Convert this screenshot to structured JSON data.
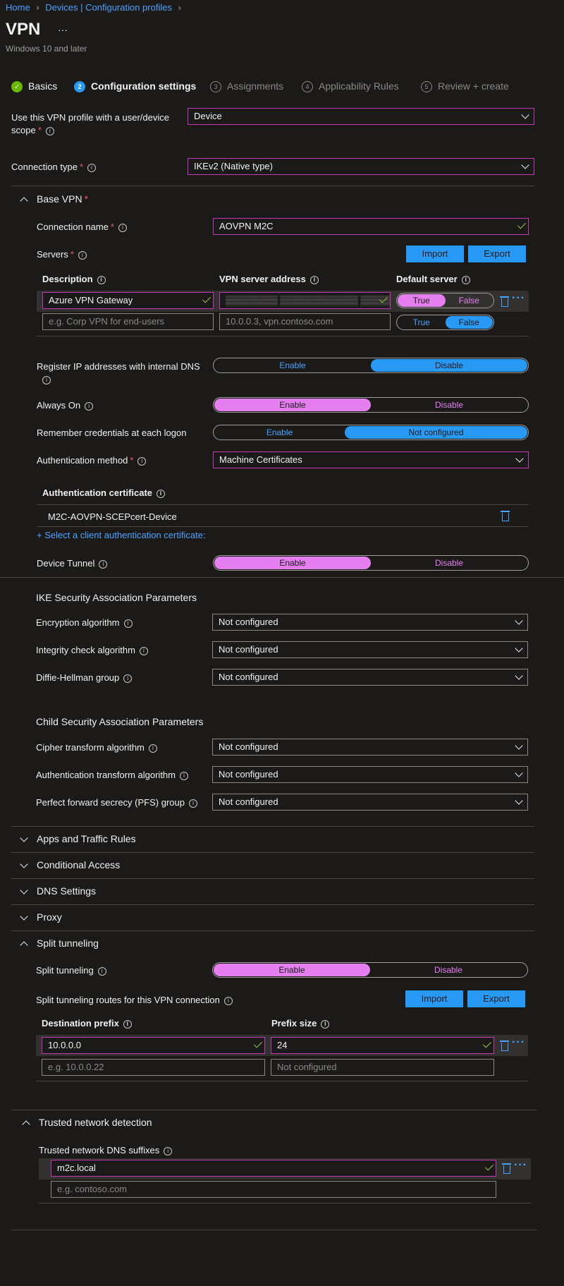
{
  "breadcrumb": [
    "Home",
    "Devices | Configuration profiles"
  ],
  "page": {
    "title": "VPN",
    "subtitle": "Windows 10 and later",
    "more": "···"
  },
  "steps": [
    {
      "num": "✓",
      "label": "Basics",
      "state": "done"
    },
    {
      "num": "2",
      "label": "Configuration settings",
      "state": "active"
    },
    {
      "num": "3",
      "label": "Assignments",
      "state": "todo"
    },
    {
      "num": "4",
      "label": "Applicability Rules",
      "state": "todo"
    },
    {
      "num": "5",
      "label": "Review + create",
      "state": "todo"
    }
  ],
  "scope": {
    "label_line1": "Use this VPN profile with a user/device",
    "label_line2": "scope",
    "value": "Device"
  },
  "connection_type": {
    "label": "Connection type",
    "value": "IKEv2 (Native type)"
  },
  "base_vpn": {
    "header": "Base VPN",
    "connection_name_label": "Connection name",
    "connection_name": "AOVPN M2C",
    "servers_label": "Servers",
    "import": "Import",
    "export": "Export",
    "col_description": "Description",
    "col_address": "VPN server address",
    "col_default": "Default server",
    "server_description": "Azure VPN Gateway",
    "server_address": "▒▒▒▒▒▒▒▒ ▒▒▒▒▒▒▒▒▒▒▒▒ ▒▒▒▒▒▒▒",
    "desc_placeholder": "e.g. Corp VPN for end-users",
    "address_placeholder": "10.0.0.3, vpn.contoso.com",
    "true": "True",
    "false": "False",
    "register_ip_label": "Register IP addresses with internal DNS",
    "enable": "Enable",
    "disable": "Disable",
    "always_on_label": "Always On",
    "remember_label": "Remember credentials at each logon",
    "not_configured": "Not configured",
    "auth_method_label": "Authentication method",
    "auth_method_value": "Machine Certificates",
    "auth_cert_header": "Authentication certificate",
    "auth_cert_value": "M2C-AOVPN-SCEPcert-Device",
    "select_cert_link": "+ Select a client authentication certificate:",
    "device_tunnel_label": "Device Tunnel"
  },
  "ike": {
    "header": "IKE Security Association Parameters",
    "rows": [
      {
        "label": "Encryption algorithm",
        "value": "Not configured"
      },
      {
        "label": "Integrity check algorithm",
        "value": "Not configured"
      },
      {
        "label": "Diffie-Hellman group",
        "value": "Not configured"
      }
    ]
  },
  "child": {
    "header": "Child Security Association Parameters",
    "rows": [
      {
        "label": "Cipher transform algorithm",
        "value": "Not configured"
      },
      {
        "label": "Authentication transform algorithm",
        "value": "Not configured"
      },
      {
        "label": "Perfect forward secrecy (PFS) group",
        "value": "Not configured"
      }
    ]
  },
  "collapsed_sections": [
    "Apps and Traffic Rules",
    "Conditional Access",
    "DNS Settings",
    "Proxy"
  ],
  "split": {
    "header": "Split tunneling",
    "label": "Split tunneling",
    "enable": "Enable",
    "disable": "Disable",
    "routes_label": "Split tunneling routes for this VPN connection",
    "import": "Import",
    "export": "Export",
    "col_dest": "Destination prefix",
    "col_prefix": "Prefix size",
    "dest_value": "10.0.0.0",
    "prefix_value": "24",
    "dest_placeholder": "e.g. 10.0.0.22",
    "prefix_placeholder": "Not configured"
  },
  "trusted": {
    "header": "Trusted network detection",
    "label": "Trusted network DNS suffixes",
    "value": "m2c.local",
    "placeholder": "e.g. contoso.com"
  },
  "colors": {
    "accent": "#2899f5",
    "pink": "#e57ff0",
    "border": "#c239b3"
  }
}
